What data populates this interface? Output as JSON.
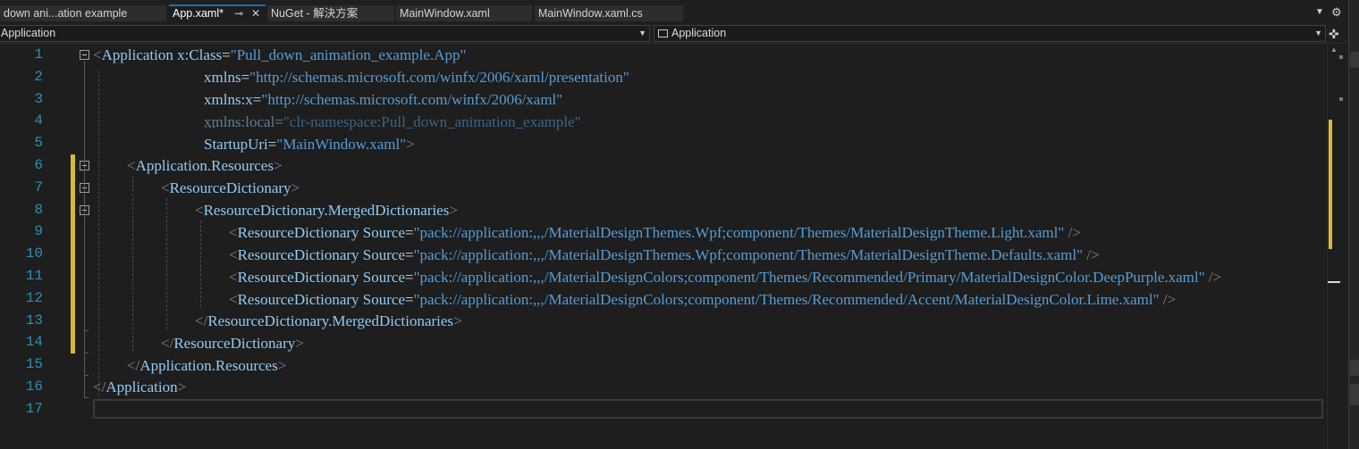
{
  "tabs": [
    {
      "label": "down ani...ation example",
      "active": false
    },
    {
      "label": "App.xaml*",
      "active": true,
      "pinned": true
    },
    {
      "label": "NuGet - 解決方案",
      "active": false
    },
    {
      "label": "MainWindow.xaml",
      "active": false
    },
    {
      "label": "MainWindow.xaml.cs",
      "active": false
    }
  ],
  "navbar": {
    "left_value": "Application",
    "right_value": "Application"
  },
  "editor": {
    "line_numbers": [
      "1",
      "2",
      "3",
      "4",
      "5",
      "6",
      "7",
      "8",
      "9",
      "10",
      "11",
      "12",
      "13",
      "14",
      "15",
      "16",
      "17"
    ],
    "lines": {
      "l1": {
        "lt": "<",
        "el": "Application",
        "attr": "x:Class",
        "eq": "=",
        "val": "\"Pull_down_animation_example.App\""
      },
      "l2": {
        "attr": "xmlns",
        "eq": "=",
        "val": "\"http://schemas.microsoft.com/winfx/2006/xaml/presentation\""
      },
      "l3": {
        "attr": "xmlns:x",
        "eq": "=",
        "val": "\"http://schemas.microsoft.com/winfx/2006/xaml\""
      },
      "l4": {
        "attr": "xmlns:local",
        "eq": "=",
        "val": "\"clr-namespace:Pull_down_animation_example\""
      },
      "l5": {
        "attr": "StartupUri",
        "eq": "=",
        "val": "\"MainWindow.xaml\"",
        "gt": ">"
      },
      "l6": {
        "lt": "<",
        "el": "Application.Resources",
        "gt": ">"
      },
      "l7": {
        "lt": "<",
        "el": "ResourceDictionary",
        "gt": ">"
      },
      "l8": {
        "lt": "<",
        "el": "ResourceDictionary.MergedDictionaries",
        "gt": ">"
      },
      "l9": {
        "lt": "<",
        "el": "ResourceDictionary",
        "attr": "Source",
        "eq": "=",
        "val": "\"pack://application:,,,/MaterialDesignThemes.Wpf;component/Themes/MaterialDesignTheme.Light.xaml\"",
        "end": " />"
      },
      "l10": {
        "lt": "<",
        "el": "ResourceDictionary",
        "attr": "Source",
        "eq": "=",
        "val": "\"pack://application:,,,/MaterialDesignThemes.Wpf;component/Themes/MaterialDesignTheme.Defaults.xaml\"",
        "end": " />"
      },
      "l11": {
        "lt": "<",
        "el": "ResourceDictionary",
        "attr": "Source",
        "eq": "=",
        "val": "\"pack://application:,,,/MaterialDesignColors;component/Themes/Recommended/Primary/MaterialDesignColor.DeepPurple.xaml\"",
        "end": " />"
      },
      "l12": {
        "lt": "<",
        "el": "ResourceDictionary",
        "attr": "Source",
        "eq": "=",
        "val": "\"pack://application:,,,/MaterialDesignColors;component/Themes/Recommended/Accent/MaterialDesignColor.Lime.xaml\"",
        "end": " />"
      },
      "l13": {
        "lt": "</",
        "el": "ResourceDictionary.MergedDictionaries",
        "gt": ">"
      },
      "l14": {
        "lt": "</",
        "el": "ResourceDictionary",
        "gt": ">"
      },
      "l15": {
        "lt": "</",
        "el": "Application.Resources",
        "gt": ">"
      },
      "l16": {
        "lt": "</",
        "el": "Application",
        "gt": ">"
      }
    },
    "current_line": 17
  },
  "colors": {
    "background": "#1e1e1e",
    "element": "#92caf4",
    "string": "#569cd6",
    "punctuation": "#808080",
    "line_number": "#2b91af",
    "change_marker": "#d7ba3a",
    "active_tab_accent": "#0e70c0"
  },
  "icons": {
    "tab_dropdown": "chevron-down-icon",
    "settings": "gear-icon",
    "pin": "pin-icon",
    "close": "close-icon",
    "split": "split-editor-icon",
    "nav_member": "class-member-icon"
  }
}
